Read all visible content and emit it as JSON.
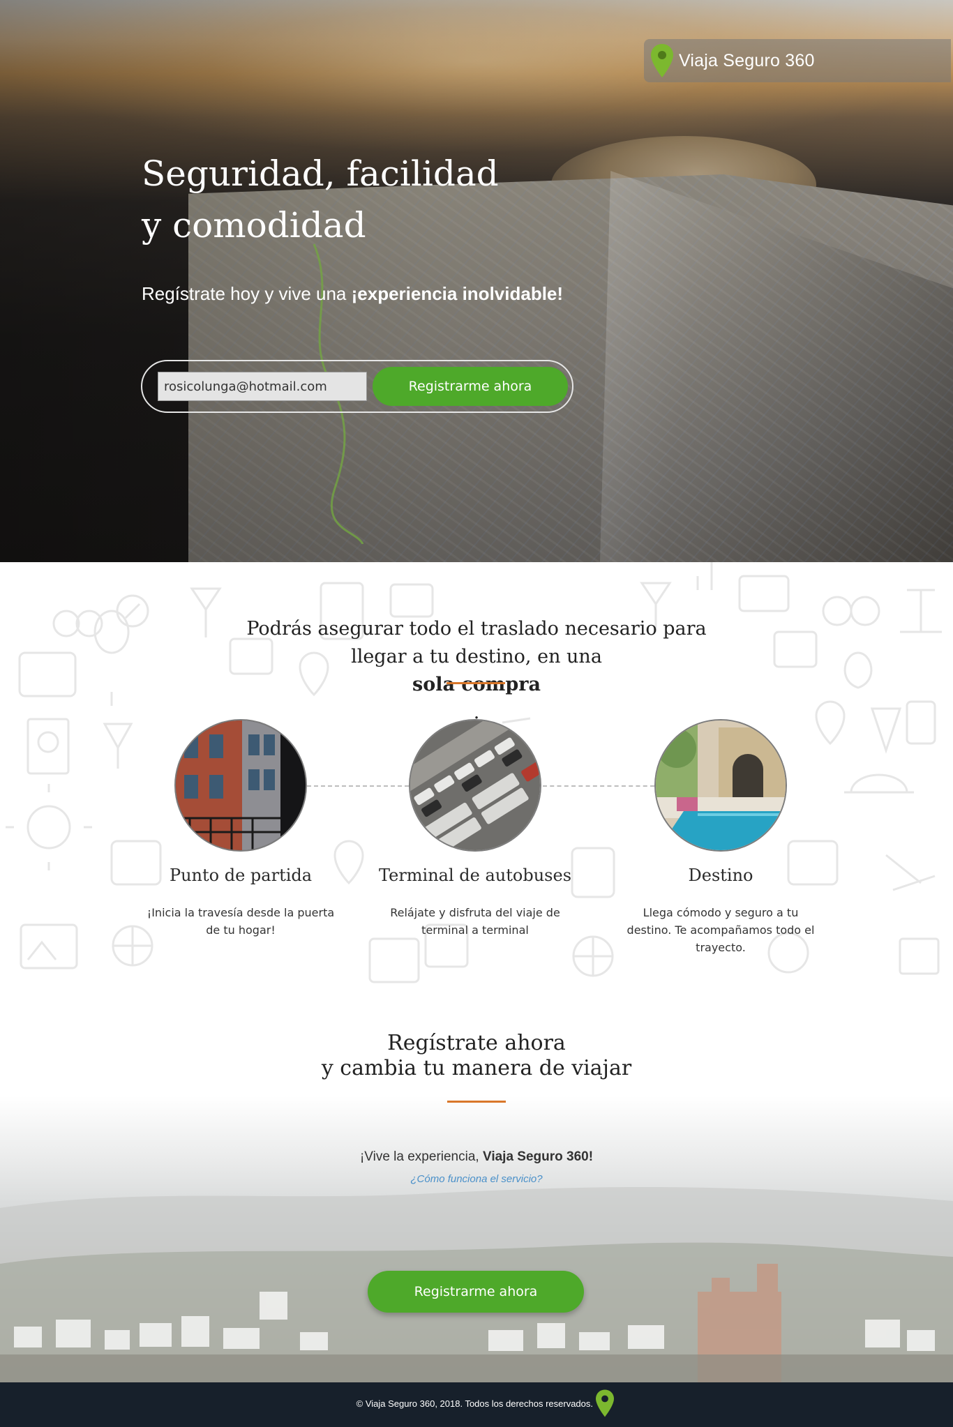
{
  "brand": {
    "name": "Viaja Seguro 360",
    "pin_color": "#7cb82f"
  },
  "hero": {
    "title_line1": "Seguridad, facilidad",
    "title_line2": "y comodidad",
    "subtitle_prefix": "Regístrate hoy y vive una ",
    "subtitle_bold": "¡experiencia inolvidable!",
    "email_value": "rosicolunga@hotmail.com",
    "register_button": "Registrarme ahora"
  },
  "features": {
    "intro_line1": "Podrás asegurar todo el traslado necesario para",
    "intro_line2_prefix": "llegar a tu destino, en una ",
    "intro_line2_bold": "sola compra",
    "intro_line2_suffix": ".",
    "accent_color": "#d9772a",
    "steps": [
      {
        "title": "Punto de partida",
        "description": "¡Inicia la travesía desde la puerta de tu hogar!",
        "icon": "building-photo"
      },
      {
        "title": "Terminal de autobuses",
        "description": "Relájate y disfruta del viaje de terminal a terminal",
        "icon": "bus-terminal-photo"
      },
      {
        "title": "Destino",
        "description": "Llega  cómodo y seguro a tu destino. Te acompañamos todo el trayecto.",
        "icon": "pool-photo"
      }
    ]
  },
  "cta": {
    "title_line1": "Regístrate ahora",
    "title_line2": "y cambia tu manera de viajar",
    "text_prefix": "¡Vive la experiencia, ",
    "text_bold": "Viaja Seguro 360!",
    "link": "¿Cómo funciona el servicio?",
    "register_button": "Registrarme ahora"
  },
  "footer": {
    "copyright": "© Viaja Seguro 360, 2018. Todos los derechos reservados."
  },
  "colors": {
    "button_green": "#4ea92a",
    "footer_bg": "#17202b",
    "link_blue": "#4a90c9"
  }
}
